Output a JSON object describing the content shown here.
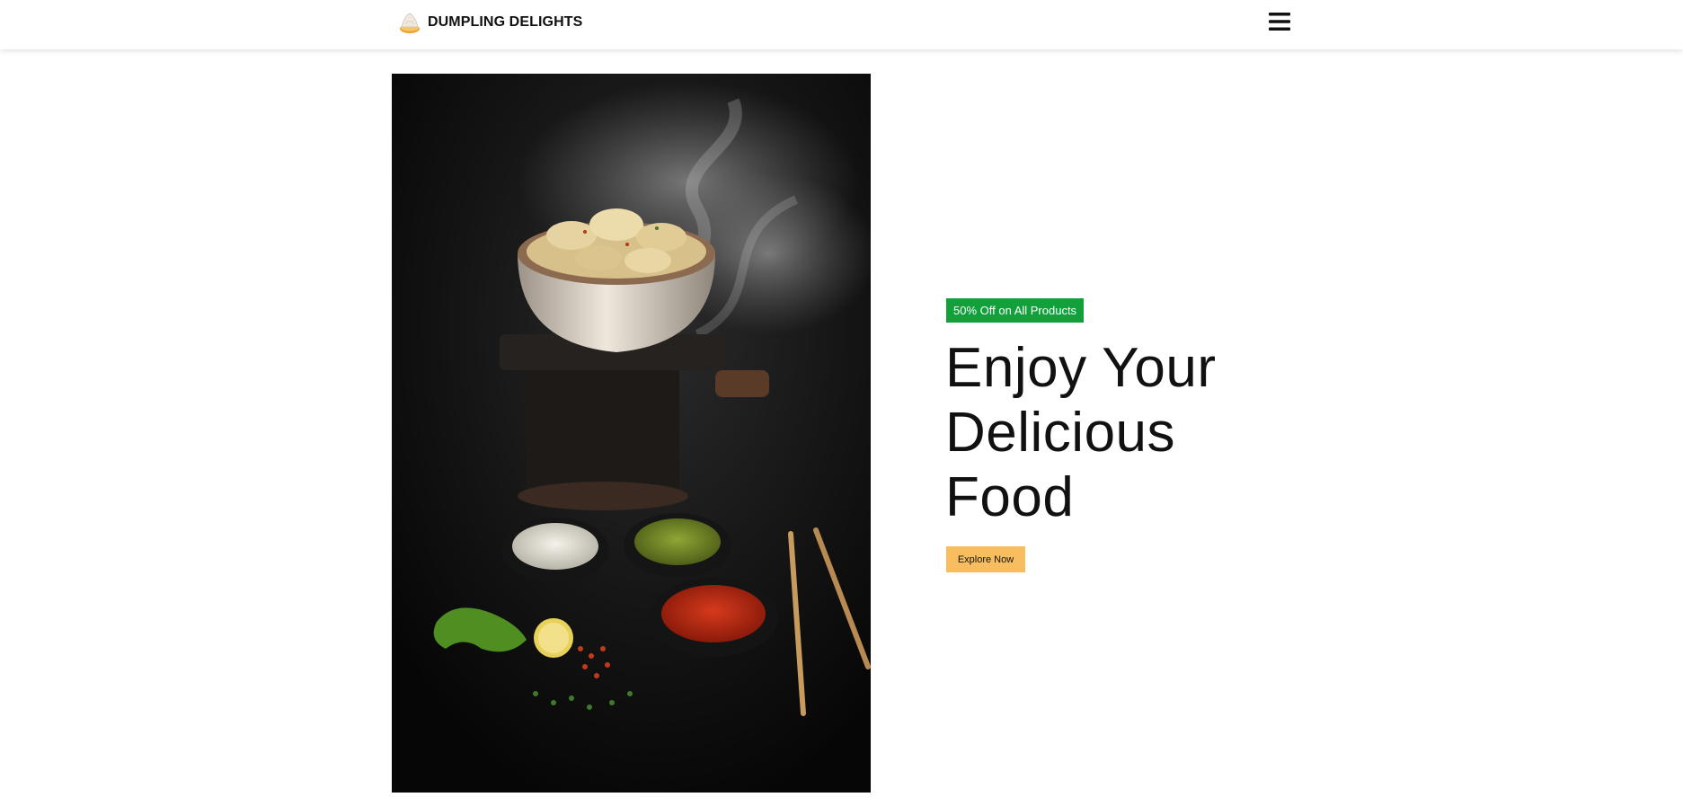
{
  "navbar": {
    "brand_name": "DUMPLING DELIGHTS",
    "logo_icon": "dumpling-icon",
    "menu_icon": "hamburger-menu-icon"
  },
  "hero": {
    "image_subject": "dumplings-in-clay-pot-with-dipping-sauces",
    "badge_text": "50% Off on All Products",
    "headline_lines": [
      "Enjoy Your",
      "Delicious",
      "Food"
    ],
    "cta_label": "Explore Now"
  },
  "colors": {
    "badge_bg": "#12a03b",
    "cta_bg": "#f8bd5e",
    "text": "#111111",
    "background": "#ffffff"
  }
}
